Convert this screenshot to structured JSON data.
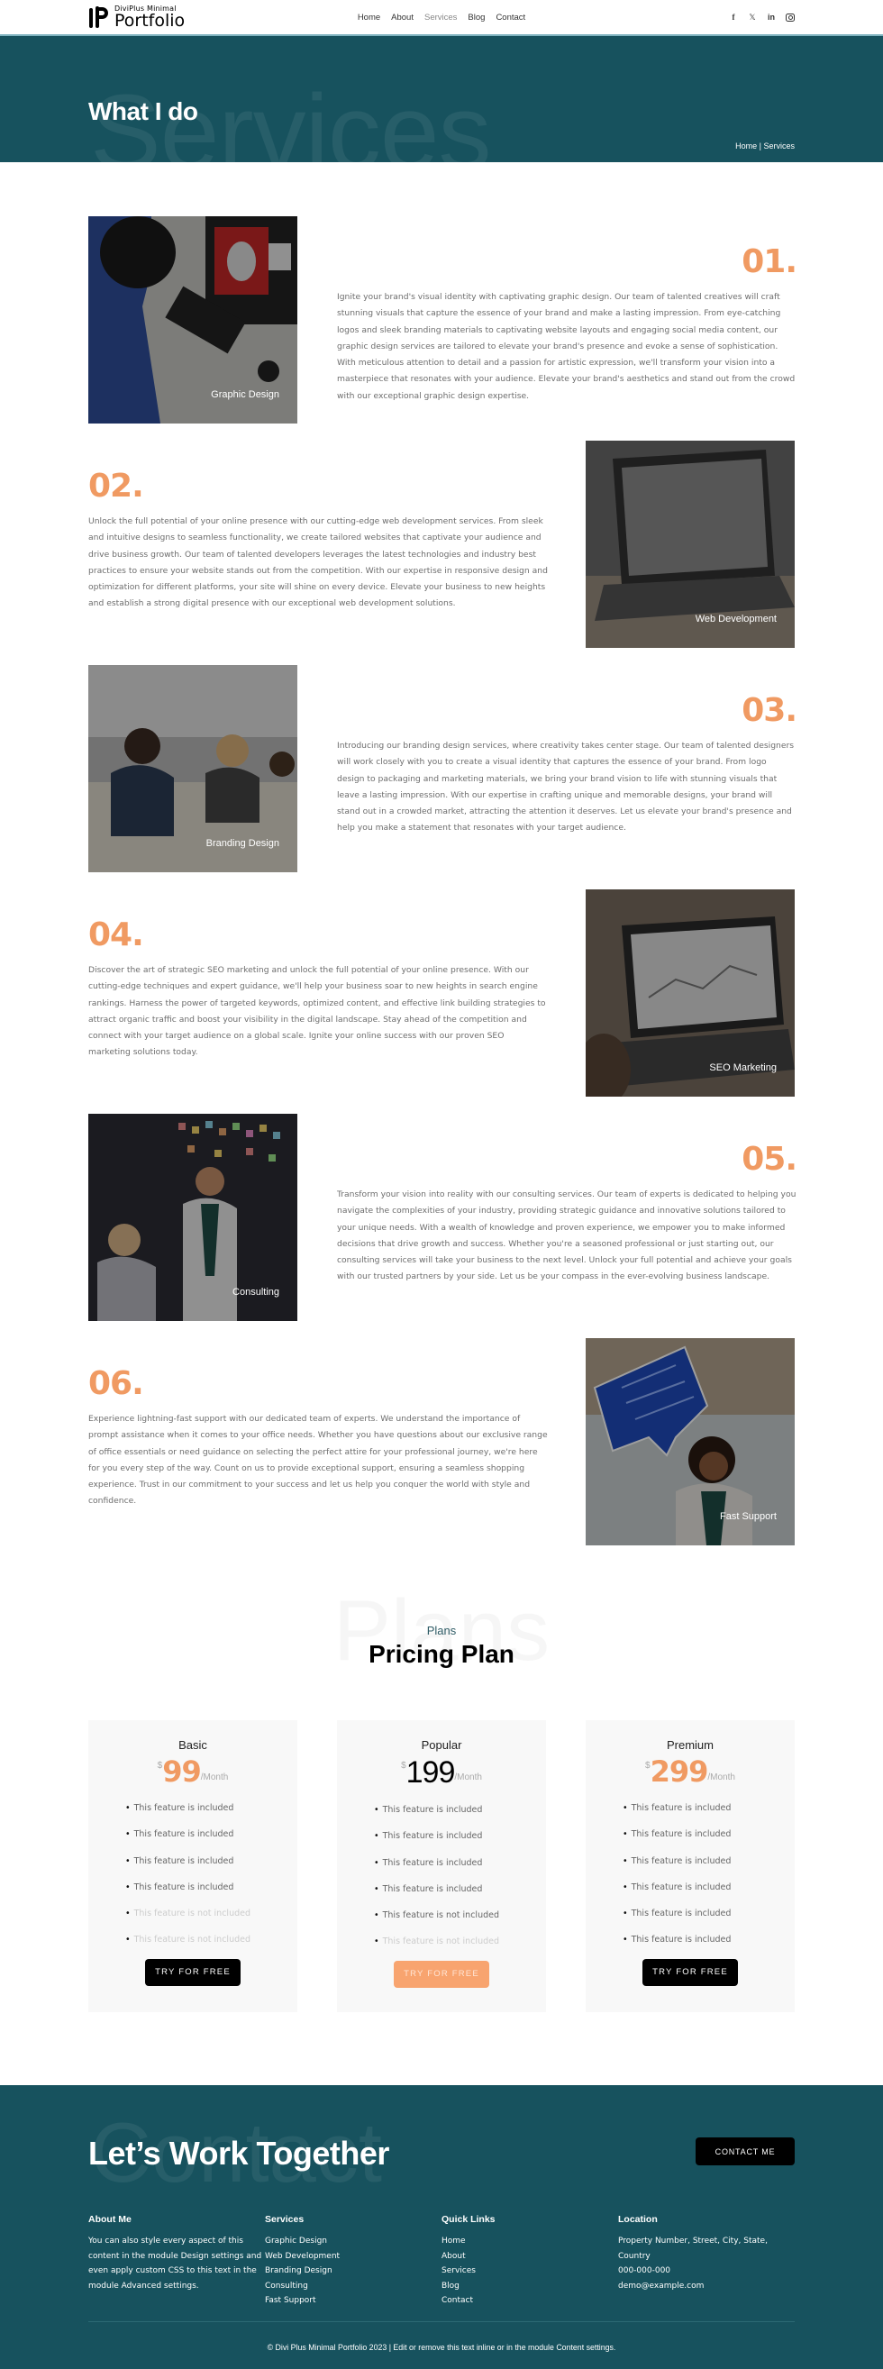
{
  "header": {
    "logo": {
      "small": "DiviPlus  Minimal",
      "big": "Portfolio"
    },
    "nav": [
      {
        "label": "Home",
        "active": false
      },
      {
        "label": "About",
        "active": false
      },
      {
        "label": "Services",
        "active": true
      },
      {
        "label": "Blog",
        "active": false
      },
      {
        "label": "Contact",
        "active": false
      }
    ],
    "social": [
      {
        "icon": "facebook-icon",
        "glyph": "f"
      },
      {
        "icon": "x-twitter-icon",
        "glyph": "𝕏"
      },
      {
        "icon": "linkedin-icon",
        "glyph": "in"
      },
      {
        "icon": "instagram-icon",
        "glyph": ""
      }
    ]
  },
  "hero": {
    "bg_word": "Services",
    "title": "What I do",
    "breadcrumb": {
      "home": "Home",
      "separator": " | ",
      "current": "Services"
    }
  },
  "services": [
    {
      "num": "01.",
      "caption": "Graphic Design",
      "side": "left",
      "desc": "Ignite your brand's visual identity with captivating graphic design. Our team of talented creatives will craft stunning visuals that capture the essence of your brand and make a lasting impression. From eye-catching logos and sleek branding materials to captivating website layouts and engaging social media content, our graphic design services are tailored to elevate your brand's presence and evoke a sense of sophistication. With meticulous attention to detail and a passion for artistic expression, we'll transform your vision into a masterpiece that resonates with your audience. Elevate your brand's aesthetics and stand out from the crowd with our exceptional graphic design expertise."
    },
    {
      "num": "02.",
      "caption": "Web Development",
      "side": "right",
      "desc": "Unlock the full potential of your online presence with our cutting-edge web development services. From sleek and intuitive designs to seamless functionality, we create tailored websites that captivate your audience and drive business growth. Our team of talented developers leverages the latest technologies and industry best practices to ensure your website stands out from the competition. With our expertise in responsive design and optimization for different platforms, your site will shine on every device. Elevate your business to new heights and establish a strong digital presence with our exceptional web development solutions."
    },
    {
      "num": "03.",
      "caption": "Branding Design",
      "side": "left",
      "desc": "Introducing our branding design services, where creativity takes center stage. Our team of talented designers will work closely with you to create a visual identity that captures the essence of your brand. From logo design to packaging and marketing materials, we bring your brand vision to life with stunning visuals that leave a lasting impression. With our expertise in crafting unique and memorable designs, your brand will stand out in a crowded market, attracting the attention it deserves. Let us elevate your brand's presence and help you make a statement that resonates with your target audience."
    },
    {
      "num": "04.",
      "caption": "SEO Marketing",
      "side": "right",
      "desc": "Discover the art of strategic SEO marketing and unlock the full potential of your online presence. With our cutting-edge techniques and expert guidance, we'll help your business soar to new heights in search engine rankings. Harness the power of targeted keywords, optimized content, and effective link building strategies to attract organic traffic and boost your visibility in the digital landscape. Stay ahead of the competition and connect with your target audience on a global scale. Ignite your online success with our proven SEO marketing solutions today."
    },
    {
      "num": "05.",
      "caption": "Consulting",
      "side": "left",
      "desc": "Transform your vision into reality with our consulting services. Our team of experts is dedicated to helping you navigate the complexities of your industry, providing strategic guidance and innovative solutions tailored to your unique needs. With a wealth of knowledge and proven experience, we empower you to make informed decisions that drive growth and success. Whether you're a seasoned professional or just starting out, our consulting services will take your business to the next level. Unlock your full potential and achieve your goals with our trusted partners by your side. Let us be your compass in the ever-evolving business landscape."
    },
    {
      "num": "06.",
      "caption": "Fast Support",
      "side": "right",
      "desc": "Experience lightning-fast support with our dedicated team of experts. We understand the importance of prompt assistance when it comes to your office needs. Whether you have questions about our exclusive range of office essentials or need guidance on selecting the perfect attire for your professional journey, we're here for you every step of the way. Count on us to provide exceptional support, ensuring a seamless shopping experience. Trust in our commitment to your success and let us help you conquer the world with style and confidence."
    }
  ],
  "pricing": {
    "bg_word": "Plans",
    "subtitle": "Plans",
    "title": "Pricing Plan",
    "plans": [
      {
        "name": "Basic",
        "currency": "$",
        "price": "99",
        "period": "/Month",
        "style": "orange",
        "button": "TRY FOR FREE",
        "button_style": "dark",
        "features": [
          {
            "text": "This feature is included",
            "included": true
          },
          {
            "text": "This feature is included",
            "included": true
          },
          {
            "text": "This feature is included",
            "included": true
          },
          {
            "text": "This feature is included",
            "included": true
          },
          {
            "text": "This feature is not included",
            "included": false
          },
          {
            "text": "This feature is not included",
            "included": false
          }
        ]
      },
      {
        "name": "Popular",
        "currency": "$",
        "price": "199",
        "period": "/Month",
        "style": "dark",
        "button": "TRY FOR FREE",
        "button_style": "orange",
        "features": [
          {
            "text": "This feature is included",
            "included": true
          },
          {
            "text": "This feature is included",
            "included": true
          },
          {
            "text": "This feature is included",
            "included": true
          },
          {
            "text": "This feature is included",
            "included": true
          },
          {
            "text": "This feature is not included",
            "included": true
          },
          {
            "text": "This feature is not included",
            "included": false
          }
        ]
      },
      {
        "name": "Premium",
        "currency": "$",
        "price": "299",
        "period": "/Month",
        "style": "orange",
        "button": "TRY FOR FREE",
        "button_style": "dark",
        "features": [
          {
            "text": "This feature is included",
            "included": true
          },
          {
            "text": "This feature is included",
            "included": true
          },
          {
            "text": "This feature is included",
            "included": true
          },
          {
            "text": "This feature is included",
            "included": true
          },
          {
            "text": "This feature is included",
            "included": true
          },
          {
            "text": "This feature is included",
            "included": true
          }
        ]
      }
    ]
  },
  "footer": {
    "bg_word": "Contact",
    "title": "Let’s Work Together",
    "contact_button": "CONTACT ME",
    "about": {
      "heading": "About Me",
      "text": "You can also style every aspect of this content in the module Design settings and even apply custom CSS to this text in the module Advanced settings."
    },
    "services": {
      "heading": "Services",
      "links": [
        "Graphic Design",
        "Web Development",
        "Branding Design",
        "Consulting",
        "Fast Support"
      ]
    },
    "quick_links": {
      "heading": "Quick Links",
      "links": [
        "Home",
        "About",
        "Services",
        "Blog",
        "Contact"
      ]
    },
    "location": {
      "heading": "Location",
      "address": "Property Number, Street, City, State, Country",
      "phone": "000-000-000",
      "email": "demo@example.com"
    },
    "copyright": "© Divi Plus Minimal Portfolio 2023 | Edit or remove this text inline or in the module Content settings."
  },
  "colors": {
    "teal": "#17525e",
    "accent": "#f09a62",
    "button_orange": "#f8a46f"
  }
}
